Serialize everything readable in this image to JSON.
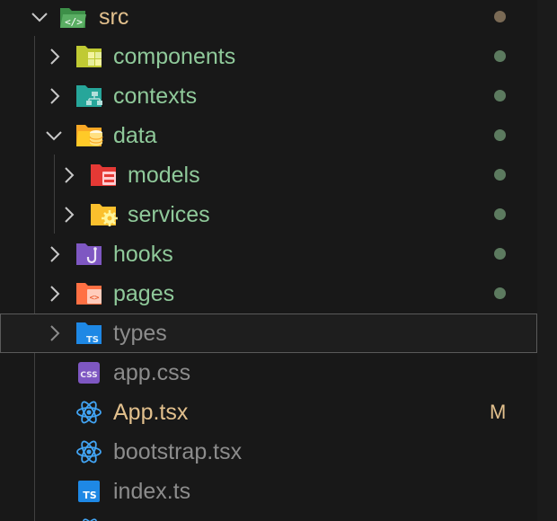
{
  "tree": {
    "root": {
      "label": "src",
      "icon": "folder-src-open-icon"
    },
    "items": [
      {
        "label": "components",
        "icon": "folder-components-icon",
        "type": "folder",
        "expanded": false
      },
      {
        "label": "contexts",
        "icon": "folder-contexts-icon",
        "type": "folder",
        "expanded": false
      },
      {
        "label": "data",
        "icon": "folder-database-open-icon",
        "type": "folder",
        "expanded": true
      },
      {
        "label": "models",
        "icon": "folder-models-icon",
        "type": "folder",
        "expanded": false
      },
      {
        "label": "services",
        "icon": "folder-services-icon",
        "type": "folder",
        "expanded": false
      },
      {
        "label": "hooks",
        "icon": "folder-hooks-icon",
        "type": "folder",
        "expanded": false
      },
      {
        "label": "pages",
        "icon": "folder-pages-icon",
        "type": "folder",
        "expanded": false
      },
      {
        "label": "types",
        "icon": "folder-typescript-icon",
        "type": "folder",
        "expanded": false
      },
      {
        "label": "app.css",
        "icon": "css-file-icon",
        "type": "file"
      },
      {
        "label": "App.tsx",
        "icon": "react-file-icon",
        "type": "file",
        "git_status": "M"
      },
      {
        "label": "bootstrap.tsx",
        "icon": "react-file-icon",
        "type": "file"
      },
      {
        "label": "index.ts",
        "icon": "typescript-file-icon",
        "type": "file"
      }
    ]
  },
  "colors": {
    "background": "#181818",
    "folder_text": "#8fc99a",
    "file_text": "#8c8c8c",
    "modified_text": "#e2c08d",
    "git_dot": "#5c7a5f",
    "focus_border": "#5a5a5a"
  }
}
